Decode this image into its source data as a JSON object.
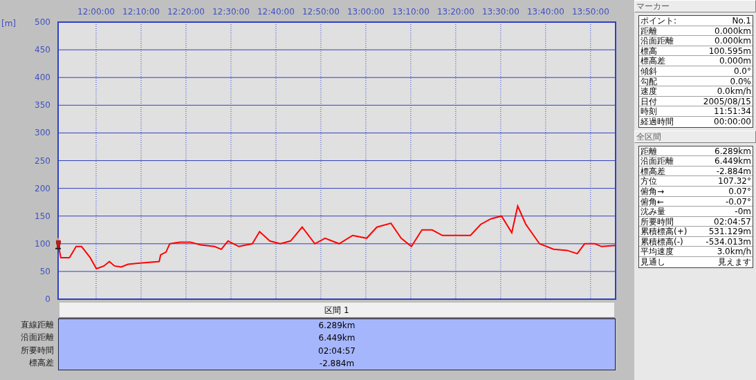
{
  "chart": {
    "chart_data": {
      "type": "line",
      "grid": true,
      "ylabel": "[m]",
      "x": [
        11.859,
        11.869,
        11.901,
        11.926,
        11.946,
        11.978,
        12.001,
        12.029,
        12.049,
        12.068,
        12.093,
        12.118,
        12.156,
        12.234,
        12.239,
        12.259,
        12.273,
        12.311,
        12.349,
        12.388,
        12.439,
        12.464,
        12.489,
        12.529,
        12.579,
        12.606,
        12.644,
        12.683,
        12.721,
        12.764,
        12.811,
        12.849,
        12.901,
        12.951,
        13.003,
        13.041,
        13.093,
        13.131,
        13.169,
        13.208,
        13.246,
        13.284,
        13.336,
        13.388,
        13.426,
        13.464,
        13.503,
        13.541,
        13.563,
        13.593,
        13.644,
        13.696,
        13.746,
        13.784,
        13.811,
        13.849,
        13.874,
        13.926
      ],
      "series": [
        {
          "color": "#ff0000",
          "values": [
            100,
            75,
            75,
            95,
            95,
            75,
            55,
            60,
            68,
            60,
            58,
            63,
            65,
            68,
            80,
            85,
            100,
            103,
            103,
            98,
            95,
            90,
            105,
            95,
            100,
            122,
            105,
            100,
            105,
            130,
            100,
            110,
            100,
            115,
            110,
            130,
            137,
            110,
            95,
            125,
            125,
            115,
            115,
            115,
            135,
            145,
            150,
            120,
            168,
            135,
            100,
            90,
            88,
            82,
            100,
            100,
            95,
            97
          ]
        }
      ],
      "xlim": [
        11.859,
        13.926
      ],
      "ylim": [
        0,
        500
      ],
      "xticks": [
        {
          "value": 12,
          "label": "12:00:00"
        },
        {
          "value": 12.1667,
          "label": "12:10:00"
        },
        {
          "value": 12.3333,
          "label": "12:20:00"
        },
        {
          "value": 12.5,
          "label": "12:30:00"
        },
        {
          "value": 12.6667,
          "label": "12:40:00"
        },
        {
          "value": 12.8333,
          "label": "12:50:00"
        },
        {
          "value": 13,
          "label": "13:00:00"
        },
        {
          "value": 13.1667,
          "label": "13:10:00"
        },
        {
          "value": 13.3333,
          "label": "13:20:00"
        },
        {
          "value": 13.5,
          "label": "13:30:00"
        },
        {
          "value": 13.6667,
          "label": "13:40:00"
        },
        {
          "value": 13.8333,
          "label": "13:50:00"
        }
      ],
      "yticks": [
        0,
        50,
        100,
        150,
        200,
        250,
        300,
        350,
        400,
        450,
        500
      ]
    }
  },
  "segment_table": {
    "header": "区間 1",
    "rows": [
      {
        "label": "直線距離",
        "value": "6.289km"
      },
      {
        "label": "沿面距離",
        "value": "6.449km"
      },
      {
        "label": "所要時間",
        "value": "02:04:57"
      },
      {
        "label": "標高差",
        "value": "-2.884m"
      }
    ]
  },
  "marker_panel": {
    "title": "マーカー",
    "rows": [
      {
        "label": "ポイント:",
        "value": "No.1"
      },
      {
        "label": "距離",
        "value": "0.000km"
      },
      {
        "label": "沿面距離",
        "value": "0.000km"
      },
      {
        "label": "標高",
        "value": "100.595m"
      },
      {
        "label": "標高差",
        "value": "0.000m"
      },
      {
        "label": "傾斜",
        "value": "0.0°"
      },
      {
        "label": "勾配",
        "value": "0.0%"
      },
      {
        "label": "速度",
        "value": "0.0km/h"
      },
      {
        "label": "日付",
        "value": "2005/08/15"
      },
      {
        "label": "時刻",
        "value": "11:51:34"
      },
      {
        "label": "経過時間",
        "value": "00:00:00"
      }
    ]
  },
  "total_panel": {
    "title": "全区間",
    "rows": [
      {
        "label": "距離",
        "value": "6.289km"
      },
      {
        "label": "沿面距離",
        "value": "6.449km"
      },
      {
        "label": "標高差",
        "value": "-2.884m"
      },
      {
        "label": "方位",
        "value": "107.32°"
      },
      {
        "label": "俯角→",
        "value": "0.07°"
      },
      {
        "label": "俯角←",
        "value": "-0.07°"
      },
      {
        "label": "沈み量",
        "value": "-0m"
      },
      {
        "label": "所要時間",
        "value": "02:04:57"
      },
      {
        "label": "累積標高(+)",
        "value": "531.129m"
      },
      {
        "label": "累積標高(-)",
        "value": "-534.013m"
      },
      {
        "label": "平均速度",
        "value": "3.0km/h"
      },
      {
        "label": "見通し",
        "value": "見えます"
      }
    ]
  }
}
